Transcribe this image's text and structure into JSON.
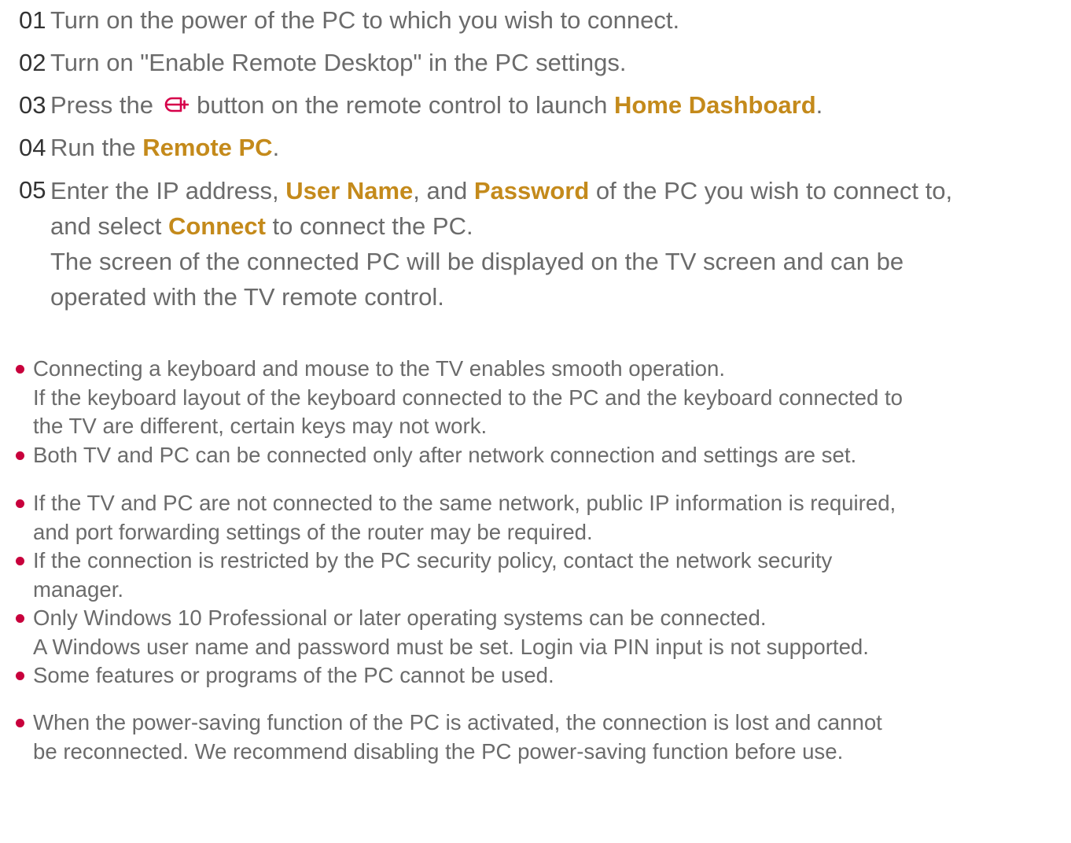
{
  "steps": [
    {
      "num": "01",
      "parts": [
        {
          "t": "Turn on the power of the PC to which you wish to connect."
        }
      ]
    },
    {
      "num": "02",
      "parts": [
        {
          "t": "Turn on \"Enable Remote Desktop\" in the PC settings."
        }
      ]
    },
    {
      "num": "03",
      "parts": [
        {
          "t": "Press the "
        },
        {
          "icon": "home-icon"
        },
        {
          "t": " button on the remote control to launch "
        },
        {
          "b": "Home Dashboard"
        },
        {
          "t": "."
        }
      ]
    },
    {
      "num": "04",
      "parts": [
        {
          "t": "Run the "
        },
        {
          "b": "Remote PC"
        },
        {
          "t": "."
        }
      ]
    },
    {
      "num": "05",
      "lines": [
        [
          {
            "t": "Enter the IP address, "
          },
          {
            "b": "User Name"
          },
          {
            "t": ", and "
          },
          {
            "b": "Password"
          },
          {
            "t": " of the PC you wish to connect to,"
          }
        ],
        [
          {
            "t": "and select "
          },
          {
            "b": "Connect"
          },
          {
            "t": " to connect the PC."
          }
        ],
        [
          {
            "t": "The screen of the connected PC will be displayed on the TV screen and can be"
          }
        ],
        [
          {
            "t": "operated with the TV remote control."
          }
        ]
      ]
    }
  ],
  "notes": [
    {
      "lines": [
        "Connecting a keyboard and mouse to the TV enables smooth operation.",
        "If the keyboard layout of the keyboard connected to the PC and the keyboard connected to",
        "the TV are different, certain keys may not work."
      ]
    },
    {
      "lines": [
        "Both TV and PC can be connected only after network connection and settings are set."
      ]
    },
    {
      "lines": [
        "If the TV and PC are not connected to the same network, public IP information is required,",
        "and port forwarding settings of the router may be required."
      ]
    },
    {
      "lines": [
        "If the connection is restricted by the PC security policy, contact the network security",
        "manager."
      ]
    },
    {
      "lines": [
        "Only Windows 10 Professional or later operating systems can be connected.",
        "A Windows user name and password must be set. Login via PIN input is not supported."
      ]
    },
    {
      "lines": [
        "Some features or programs of the PC cannot be used."
      ]
    },
    {
      "lines": [
        "When the power-saving function of the PC is activated, the connection is lost and cannot",
        "be reconnected. We recommend disabling the PC power-saving function before use."
      ]
    }
  ],
  "colors": {
    "accent": "#c48a1b",
    "bullet": "#c8003c",
    "icon": "#d6004a"
  }
}
